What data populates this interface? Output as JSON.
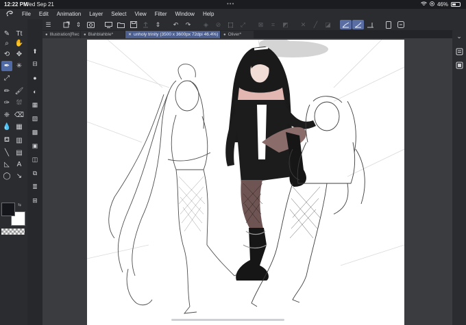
{
  "status": {
    "time": "12:22 PM",
    "date": "Wed Sep 21",
    "battery": "46%",
    "battery_level": 0.46
  },
  "menu": {
    "items": [
      "File",
      "Edit",
      "Animation",
      "Layer",
      "Select",
      "View",
      "Filter",
      "Window",
      "Help"
    ]
  },
  "tabs": [
    {
      "label": "Illustration[Rec",
      "active": false
    },
    {
      "label": "Blahblahble*",
      "active": false
    },
    {
      "label": "unholy trinity (3500 x 3600px 72dpi 46.4%)",
      "active": true
    },
    {
      "label": "Oliver*",
      "active": false
    }
  ],
  "icons": {
    "app_logo": "clip-studio-logo",
    "tab_close": "close-icon",
    "panel_toggle": "chevron-down-icon"
  },
  "colors": {
    "accent": "#4f6aa5",
    "foreground_color": "#14161c",
    "background_color": "#ffffff"
  }
}
